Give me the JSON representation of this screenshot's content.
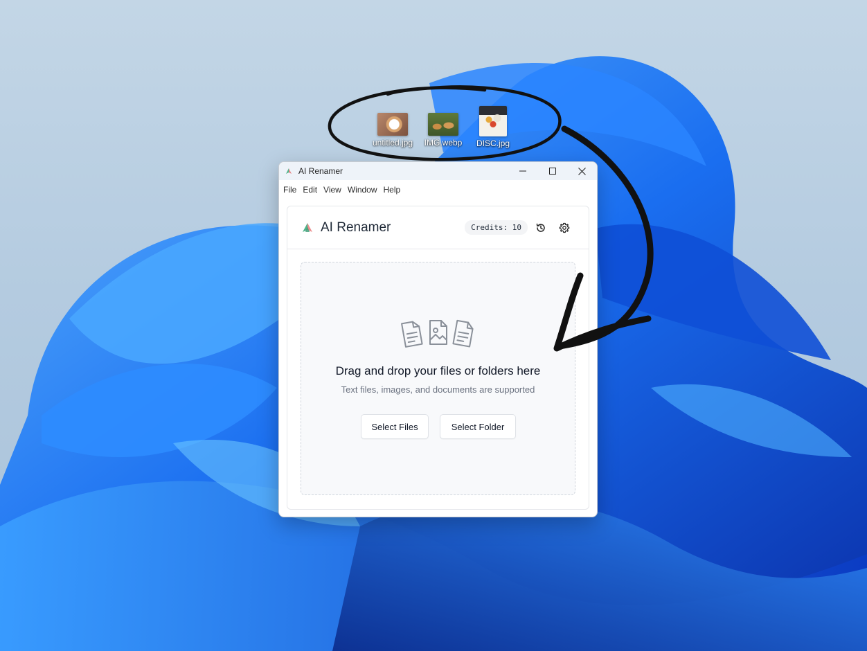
{
  "desktop": {
    "icons": [
      {
        "label": "untitled.jpg",
        "icon": "photo-file-icon"
      },
      {
        "label": "IMG.webp",
        "icon": "photo-file-icon"
      },
      {
        "label": "DISC.jpg",
        "icon": "photo-file-icon"
      }
    ]
  },
  "window": {
    "title": "AI Renamer",
    "controls": {
      "minimize": "minimize-icon",
      "maximize": "maximize-icon",
      "close": "close-icon"
    },
    "menu": [
      "File",
      "Edit",
      "View",
      "Window",
      "Help"
    ]
  },
  "app": {
    "brand": "AI Renamer",
    "credits": "Credits: 10",
    "header_icons": [
      "history-icon",
      "gear-icon"
    ],
    "dropzone": {
      "title": "Drag and drop your files or folders here",
      "subtitle": "Text files, images, and documents are supported",
      "select_files": "Select Files",
      "select_folder": "Select Folder"
    }
  },
  "colors": {
    "accent_green": "#4fb38a",
    "accent_red": "#e66a6a",
    "wallpaper_blue": "#1a5fe0"
  }
}
